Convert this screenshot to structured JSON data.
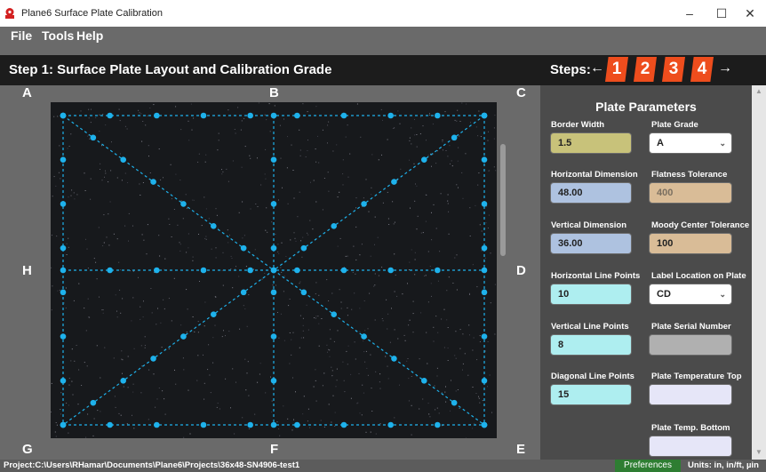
{
  "window": {
    "title": "Plane6 Surface Plate Calibration"
  },
  "menu": [
    "File",
    "Tools",
    "Help"
  ],
  "header": {
    "step_title": "Step 1: Surface Plate Layout and Calibration Grade",
    "steps_label": "Steps:",
    "left_arrow": "←",
    "right_arrow": "→",
    "steps": [
      "1",
      "2",
      "3",
      "4"
    ]
  },
  "corners": {
    "A": "A",
    "B": "B",
    "C": "C",
    "D": "D",
    "E": "E",
    "F": "F",
    "G": "G",
    "H": "H"
  },
  "panel": {
    "title": "Plate Parameters",
    "border_width": {
      "label": "Border Width",
      "value": "1.5"
    },
    "plate_grade": {
      "label": "Plate Grade",
      "value": "A"
    },
    "horizontal_dimension": {
      "label": "Horizontal Dimension",
      "value": "48.00"
    },
    "flatness_tolerance": {
      "label": "Flatness Tolerance",
      "value": "400"
    },
    "vertical_dimension": {
      "label": "Vertical Dimension",
      "value": "36.00"
    },
    "moody_center_tolerance": {
      "label": "Moody Center Tolerance",
      "value": "100"
    },
    "horizontal_line_points": {
      "label": "Horizontal Line Points",
      "value": "10"
    },
    "label_location": {
      "label": "Label Location on Plate",
      "value": "CD"
    },
    "vertical_line_points": {
      "label": "Vertical Line Points",
      "value": "8"
    },
    "plate_serial_number": {
      "label": "Plate Serial Number",
      "value": ""
    },
    "diagonal_line_points": {
      "label": "Diagonal Line Points",
      "value": "15"
    },
    "plate_temperature_top": {
      "label": "Plate Temperature Top",
      "value": ""
    },
    "plate_temp_bottom": {
      "label": "Plate Temp. Bottom",
      "value": ""
    }
  },
  "status": {
    "project": "Project:C:\\Users\\RHamar\\Documents\\Plane6\\Projects\\36x48-SN4906-test1",
    "preferences": "Preferences",
    "units": "Units: in, in/ft, µin"
  },
  "colors": {
    "step_orange": "#ee4d1d",
    "point_blue": "#1eb2ec",
    "border_field": "#c8c27a",
    "dimension_field": "#aec2e0",
    "tolerance_field": "#d9bc97",
    "points_field": "#aeeef0",
    "grade_field": "#ffffff",
    "empty_field": "#b0b0b0",
    "temp_field": "#e6e6f8",
    "preferences_green": "#2e7d32"
  }
}
